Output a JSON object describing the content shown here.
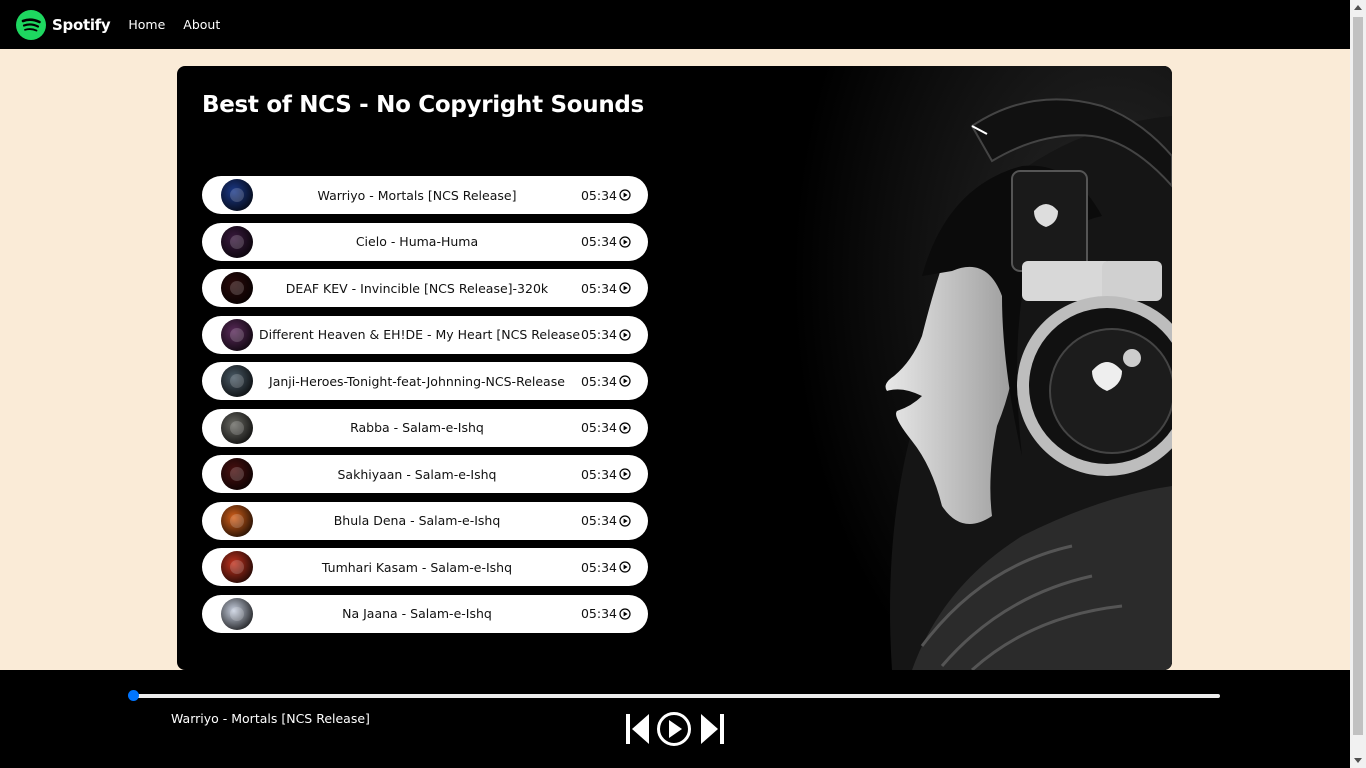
{
  "nav": {
    "brand": "Spotify",
    "logo_icon": "spotify-logo-icon",
    "links": [
      {
        "label": "Home"
      },
      {
        "label": "About"
      }
    ]
  },
  "playlist": {
    "title": "Best of NCS - No Copyright Sounds",
    "songs": [
      {
        "name": "Warriyo - Mortals [NCS Release]",
        "duration": "05:34",
        "cover_color": "#1c3a8a"
      },
      {
        "name": "Cielo - Huma-Huma",
        "duration": "05:34",
        "cover_color": "#3a1a3f"
      },
      {
        "name": "DEAF KEV - Invincible [NCS Release]-320k",
        "duration": "05:34",
        "cover_color": "#2a0a0a"
      },
      {
        "name": "Different Heaven & EH!DE - My Heart [NCS Release]",
        "duration": "05:34",
        "cover_color": "#5a2a5a"
      },
      {
        "name": "Janji-Heroes-Tonight-feat-Johnning-NCS-Release",
        "duration": "05:34",
        "cover_color": "#4a5a66"
      },
      {
        "name": "Rabba - Salam-e-Ishq",
        "duration": "05:34",
        "cover_color": "#6a6a64"
      },
      {
        "name": "Sakhiyaan - Salam-e-Ishq",
        "duration": "05:34",
        "cover_color": "#4a1010"
      },
      {
        "name": "Bhula Dena - Salam-e-Ishq",
        "duration": "05:34",
        "cover_color": "#d4601a"
      },
      {
        "name": "Tumhari Kasam - Salam-e-Ishq",
        "duration": "05:34",
        "cover_color": "#c2331f"
      },
      {
        "name": "Na Jaana - Salam-e-Ishq",
        "duration": "05:34",
        "cover_color": "#c8d0e0"
      }
    ]
  },
  "player": {
    "now_playing": "Warriyo - Mortals [NCS Release]",
    "progress_percent": 0,
    "accent_color": "#0075ff",
    "controls": [
      "skip-previous-icon",
      "play-circle-icon",
      "skip-next-icon"
    ]
  }
}
